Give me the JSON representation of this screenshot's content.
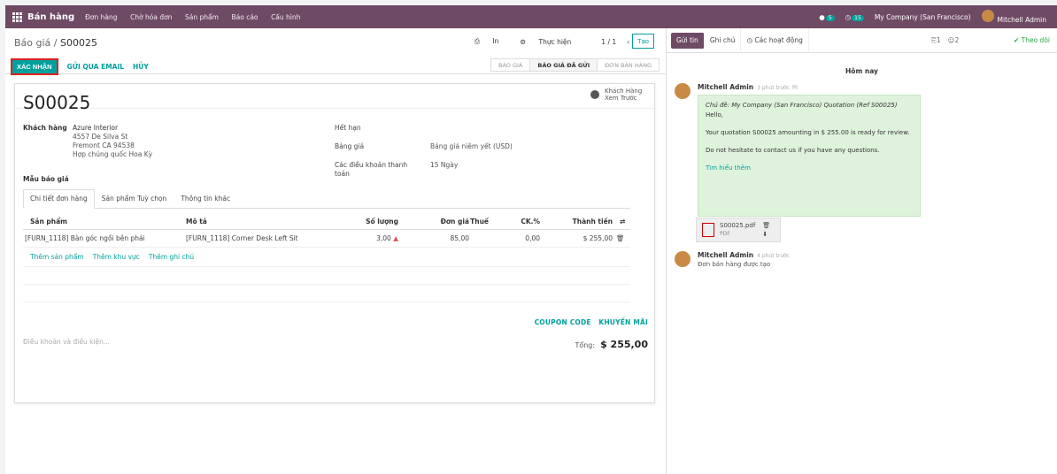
{
  "topbar": {
    "app_name": "Bán hàng",
    "menu": [
      "Đơn hàng",
      "Chờ hóa đơn",
      "Sản phẩm",
      "Báo cáo",
      "Cấu hình"
    ],
    "chat_count": "5",
    "activity_count": "15",
    "company": "My Company (San Francisco)",
    "user": "Mitchell Admin"
  },
  "control": {
    "breadcrumb_parent": "Báo giá",
    "breadcrumb_sep": " / ",
    "breadcrumb_current": "S00025",
    "print": "In",
    "action": "Thực hiện",
    "pager": "1 / 1",
    "create": "Tạo",
    "confirm": "XÁC NHẬN",
    "send_email": "GỬI QUA EMAIL",
    "cancel": "HỦY",
    "status": [
      "BÁO GIÁ",
      "BÁO GIÁ ĐÃ GỬI",
      "ĐƠN BÁN HÀNG"
    ],
    "status_active": 1
  },
  "form": {
    "preview": "Khách Hàng Xem Trước",
    "number": "S00025",
    "customer_label": "Khách hàng",
    "customer_name": "Azure Interior",
    "address1": "4557 De Silva St",
    "address2": "Fremont CA 94538",
    "address3": "Hợp chủng quốc Hoa Kỳ",
    "template_label": "Mẫu báo giá",
    "expiry_label": "Hết hạn",
    "pricelist_label": "Bảng giá",
    "pricelist_value": "Bảng giá niêm yết (USD)",
    "terms_label": "Các điều khoản thanh toán",
    "terms_value": "15 Ngày"
  },
  "tabs": [
    "Chi tiết đơn hàng",
    "Sản phẩm Tuỳ chọn",
    "Thông tin khác"
  ],
  "table": {
    "headers": [
      "Sản phẩm",
      "Mô tả",
      "Số lượng",
      "Đơn giá",
      "Thuế",
      "CK.%",
      "Thành tiền"
    ],
    "row": {
      "product": "[FURN_1118] Bàn góc ngồi bên phải",
      "description": "[FURN_1118] Corner Desk Left Sit",
      "qty": "3,00",
      "price": "85,00",
      "tax": "",
      "discount": "0,00",
      "subtotal": "$ 255,00"
    },
    "add_product": "Thêm sản phẩm",
    "add_section": "Thêm khu vực",
    "add_note": "Thêm ghi chú"
  },
  "bottom": {
    "terms_placeholder": "Điều khoản và điều kiện...",
    "coupon": "COUPON CODE",
    "promo": "KHUYẾN MÃI",
    "total_label": "Tổng:",
    "total_value": "$ 255,00"
  },
  "chatter": {
    "send": "Gửi tin",
    "note": "Ghi chú",
    "activities": "Các hoạt động",
    "attachments": "1",
    "followers": "2",
    "follow": "Theo dõi",
    "today": "Hôm nay",
    "msg1_author": "Mitchell Admin",
    "msg1_time": "3 phút trước",
    "msg1_subject": "Chủ đề: My Company (San Francisco) Quotation (Ref S00025)",
    "msg1_hello": "Hello,",
    "msg1_body": "Your quotation S00025 amounting in $ 255.00 is ready for review.",
    "msg1_contact": "Do not hesitate to contact us if you have any questions.",
    "msg1_link": "Tìm hiểu thêm",
    "file_name": "S00025.pdf",
    "file_type": "PDF",
    "msg2_author": "Mitchell Admin",
    "msg2_time": "4 phút trước",
    "msg2_body": "Đơn bán hàng được tạo"
  }
}
